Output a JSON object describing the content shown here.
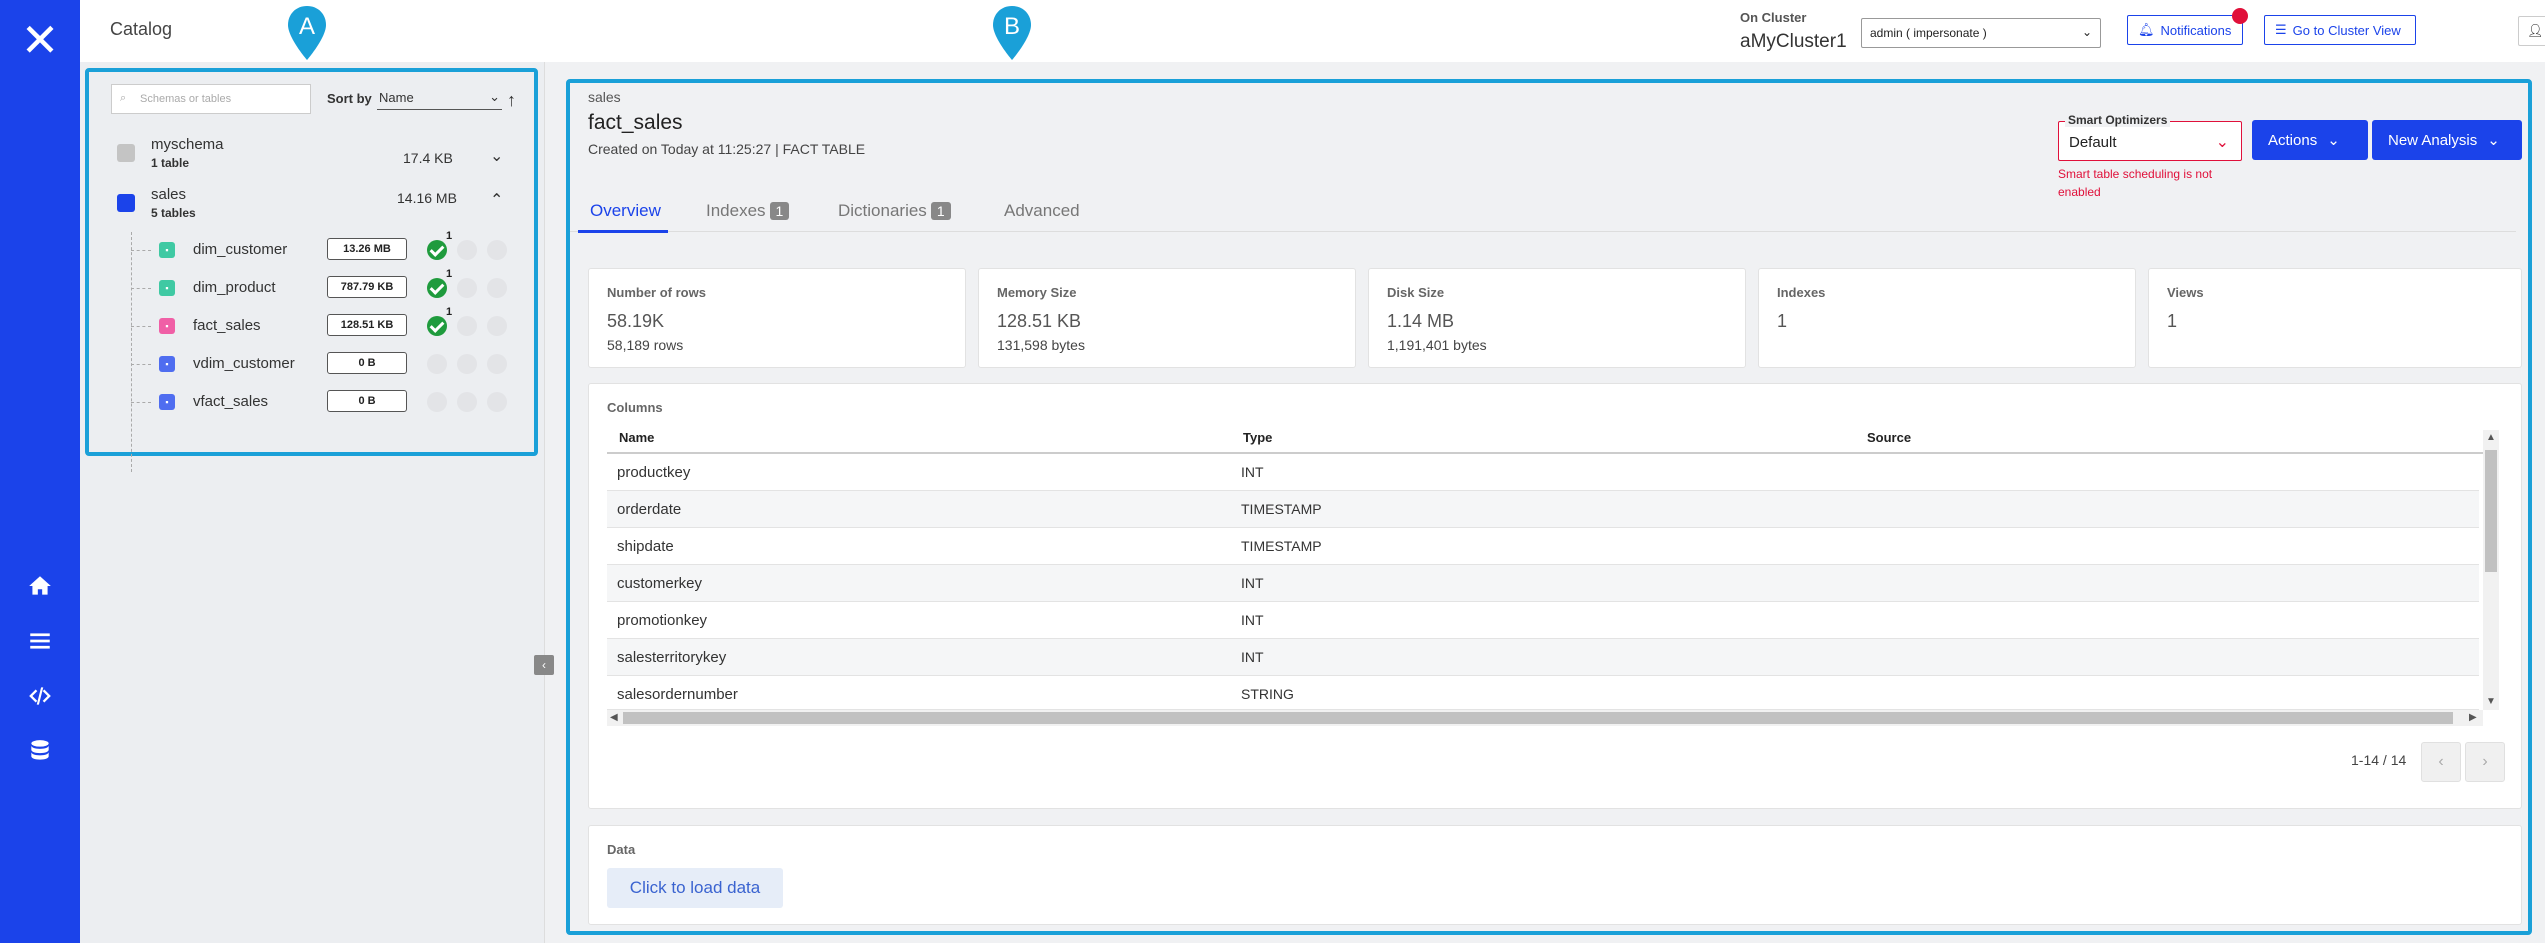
{
  "header": {
    "page_title": "Catalog",
    "on_cluster_label": "On Cluster",
    "cluster_name": "aMyCluster1",
    "user_select": "admin ( impersonate )",
    "notifications": "Notifications",
    "go_to_cluster": "Go to Cluster View",
    "admin": "admin"
  },
  "markers": {
    "a": "A",
    "b": "B"
  },
  "left_panel": {
    "search_placeholder": "Schemas or tables",
    "sort_by_label": "Sort by",
    "sort_by_value": "Name",
    "schemas": [
      {
        "name": "myschema",
        "count": "1 table",
        "size": "17.4 KB",
        "color": "#c4c4c4",
        "expanded": false
      },
      {
        "name": "sales",
        "count": "5 tables",
        "size": "14.16 MB",
        "color": "#1b43ea",
        "expanded": true
      }
    ],
    "tables": [
      {
        "name": "dim_customer",
        "size": "13.26 MB",
        "color": "#3fc9a3",
        "checked": true,
        "count": "1"
      },
      {
        "name": "dim_product",
        "size": "787.79 KB",
        "color": "#3fc9a3",
        "checked": true,
        "count": "1"
      },
      {
        "name": "fact_sales",
        "size": "128.51 KB",
        "color": "#f05fa6",
        "checked": true,
        "count": "1"
      },
      {
        "name": "vdim_customer",
        "size": "0 B",
        "color": "#4f6df0",
        "checked": false,
        "count": ""
      },
      {
        "name": "vfact_sales",
        "size": "0 B",
        "color": "#4f6df0",
        "checked": false,
        "count": ""
      }
    ]
  },
  "main": {
    "breadcrumb": "sales",
    "title": "fact_sales",
    "created": "Created on Today at 11:25:27 | FACT TABLE",
    "smart_optimizers_label": "Smart Optimizers",
    "smart_optimizers_value": "Default",
    "smart_warning": "Smart table scheduling is not enabled",
    "actions": "Actions",
    "new_analysis": "New Analysis",
    "tabs": [
      {
        "label": "Overview",
        "badge": ""
      },
      {
        "label": "Indexes",
        "badge": "1"
      },
      {
        "label": "Dictionaries",
        "badge": "1"
      },
      {
        "label": "Advanced",
        "badge": ""
      }
    ],
    "stats": [
      {
        "label": "Number of rows",
        "big": "58.19K",
        "small": "58,189 rows"
      },
      {
        "label": "Memory Size",
        "big": "128.51 KB",
        "small": "131,598 bytes"
      },
      {
        "label": "Disk Size",
        "big": "1.14 MB",
        "small": "1,191,401 bytes"
      },
      {
        "label": "Indexes",
        "big": "1",
        "small": ""
      },
      {
        "label": "Views",
        "big": "1",
        "small": ""
      }
    ],
    "columns_title": "Columns",
    "column_headers": [
      "Name",
      "Type",
      "Source"
    ],
    "columns": [
      {
        "name": "productkey",
        "type": "INT"
      },
      {
        "name": "orderdate",
        "type": "TIMESTAMP"
      },
      {
        "name": "shipdate",
        "type": "TIMESTAMP"
      },
      {
        "name": "customerkey",
        "type": "INT"
      },
      {
        "name": "promotionkey",
        "type": "INT"
      },
      {
        "name": "salesterritorykey",
        "type": "INT"
      },
      {
        "name": "salesordernumber",
        "type": "STRING"
      }
    ],
    "pager": "1-14 / 14",
    "data_title": "Data",
    "load_data": "Click to load data"
  }
}
